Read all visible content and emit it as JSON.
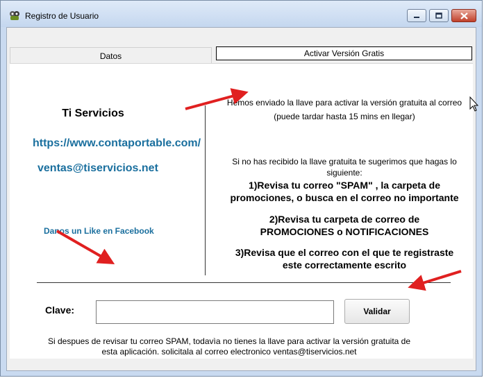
{
  "window": {
    "title": "Registro de Usuario",
    "icons": {
      "app": "app-icon",
      "minimize": "minimize-icon",
      "maximize": "maximize-icon",
      "close": "close-icon"
    }
  },
  "tabs": [
    {
      "label": "Datos",
      "active": false
    },
    {
      "label": "Activar Versión Gratis",
      "active": true
    }
  ],
  "left": {
    "company": "Ti Servicios",
    "url": "https://www.contaportable.com/",
    "email": "ventas@tiservicios.net",
    "facebook": "Danos un Like en Facebook"
  },
  "right": {
    "message_line1": "Hemos enviado la llave para activar la versión gratuita al correo",
    "message_line2": "(puede tardar hasta 15 mins en llegar)",
    "suggestion_line1": "Si no has recibido la llave gratuita te sugerimos que hagas lo",
    "suggestion_line2": "siguiente:",
    "step1_line1": "1)Revisa tu correo \"SPAM\" , la carpeta de",
    "step1_line2": "promociones, o busca en el correo no importante",
    "step2_line1": "2)Revisa tu carpeta de correo de",
    "step2_line2": "PROMOCIONES o NOTIFICACIONES",
    "step3_line1": "3)Revisa que el correo con el que te registraste",
    "step3_line2": "este correctamente escrito"
  },
  "form": {
    "clave_label": "Clave:",
    "clave_value": "",
    "validar_label": "Validar"
  },
  "footer": {
    "line1": "Si despues de revisar tu correo SPAM, todavìa no tienes la llave para activar la versión gratuita de",
    "line2": "esta aplicación. solicitala al correo electronico  ventas@tiservicios.net"
  },
  "colors": {
    "link": "#1a6f9e",
    "annotation_arrow": "#e02020",
    "title_bar": "#c9daf0",
    "close_button": "#c0402a"
  }
}
